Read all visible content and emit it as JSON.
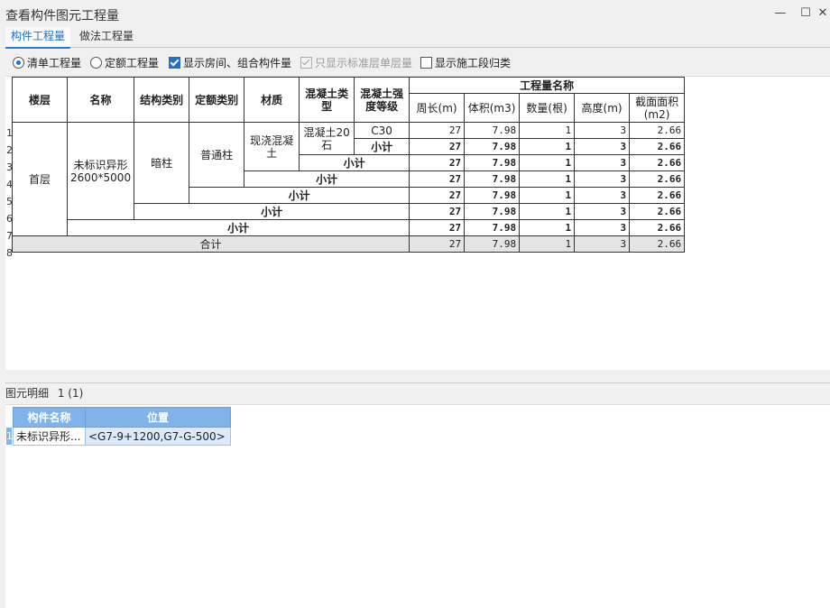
{
  "window": {
    "title": "查看构件图元工程量",
    "minimize_glyph": "—",
    "maximize_glyph": "☐",
    "close_glyph": "✕"
  },
  "tabs": [
    {
      "label": "构件工程量",
      "active": true
    },
    {
      "label": "做法工程量",
      "active": false
    }
  ],
  "options": {
    "radio_list": "清单工程量",
    "radio_quota": "定额工程量",
    "show_rooms": "显示房间、组合构件量",
    "only_standard": "只显示标准层单层量",
    "show_sections": "显示施工段归类"
  },
  "table": {
    "headers": {
      "floor": "楼层",
      "name": "名称",
      "struct_type": "结构类别",
      "quota_type": "定额类别",
      "material": "材质",
      "concrete_type": "混凝土类型",
      "concrete_grade": "混凝土强度等级",
      "quantity_name": "工程量名称",
      "perimeter": "周长(m)",
      "volume": "体积(m3)",
      "count": "数量(根)",
      "height": "高度(m)",
      "area": "截面面积(m2)"
    },
    "row_numbers": [
      "1",
      "2",
      "3",
      "4",
      "5",
      "6",
      "7",
      "8"
    ],
    "floor": "首层",
    "name": "未标识异形2600*5000",
    "struct_type": "暗柱",
    "quota_type": "普通柱",
    "material": "现浇混凝土",
    "concrete_type": "混凝土20石",
    "concrete_grade": "C30",
    "subtotal": "小计",
    "total": "合计",
    "values": {
      "perimeter": "27",
      "volume": "7.98",
      "count": "1",
      "height": "3",
      "area": "2.66"
    }
  },
  "detail": {
    "label": "图元明细",
    "count": "1 (1)",
    "headers": {
      "name": "构件名称",
      "position": "位置"
    },
    "row_number": "1",
    "row": {
      "name": "未标识异形...",
      "position": "<G7-9+1200,G7-G-500>"
    }
  }
}
